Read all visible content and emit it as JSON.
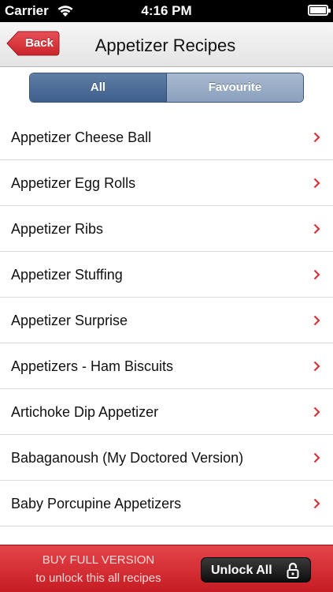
{
  "status_bar": {
    "carrier": "Carrier",
    "time": "4:16 PM",
    "icons": [
      "wifi-icon",
      "battery-icon"
    ]
  },
  "nav": {
    "back_label": "Back",
    "title": "Appetizer Recipes",
    "accent_color": "#d9323a"
  },
  "segment": {
    "options": [
      "All",
      "Favourite"
    ],
    "selected": "All"
  },
  "recipes": [
    "Appetizer Cheese Ball",
    "Appetizer Egg Rolls",
    "Appetizer Ribs",
    "Appetizer Stuffing",
    "Appetizer Surprise",
    "Appetizers - Ham Biscuits",
    "Artichoke Dip Appetizer",
    "Babaganoush (My Doctored Version)",
    "Baby Porcupine Appetizers"
  ],
  "banner": {
    "line1": "BUY FULL VERSION",
    "line2": "to unlock this all recipes",
    "unlock_label": "Unlock All",
    "icon": "lock-icon"
  }
}
